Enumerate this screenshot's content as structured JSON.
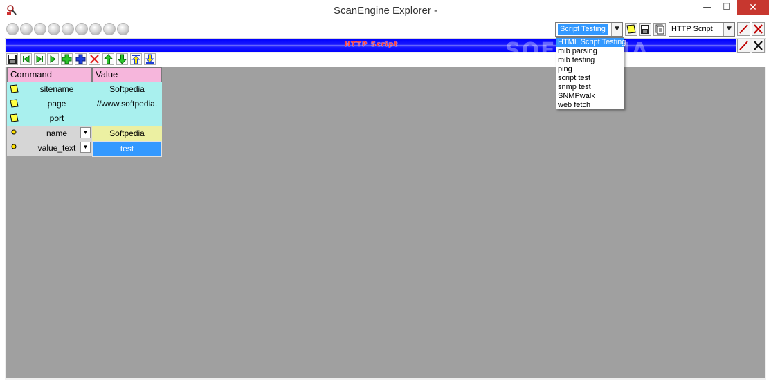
{
  "window": {
    "title": "ScanEngine Explorer -",
    "minimize": "—",
    "maximize": "☐",
    "close": "✕"
  },
  "toolbar": {
    "led_count": 9,
    "script_combo": {
      "selected": "Script Testing"
    },
    "type_combo": {
      "selected": "HTTP Script"
    }
  },
  "banner": {
    "label": "HTTP Script"
  },
  "grid": {
    "headers": {
      "command": "Command",
      "value": "Value"
    },
    "rows": [
      {
        "command": "sitename",
        "value": "Softpedia",
        "icon": "note-icon"
      },
      {
        "command": "page",
        "value": "//www.softpedia.",
        "icon": "note-icon"
      },
      {
        "command": "port",
        "value": "",
        "icon": "note-icon"
      },
      {
        "command": "name",
        "value": "Softpedia",
        "icon": "dot-icon"
      },
      {
        "command": "value_text",
        "value": "test",
        "icon": "dot-icon"
      }
    ]
  },
  "dropdown": {
    "items": [
      "HTML Script Testing",
      "mib parsing",
      "mib testing",
      "ping",
      "script test",
      "snmp test",
      "SNMPwalk",
      "web fetch"
    ],
    "highlighted_index": 0
  },
  "watermark": "SOFTPEDIA",
  "colors": {
    "accent": "#3399ff",
    "banner": "#0000ff",
    "header": "#f6b6dc",
    "row_cyan": "#a9f0ee",
    "workspace": "#a0a0a0"
  }
}
